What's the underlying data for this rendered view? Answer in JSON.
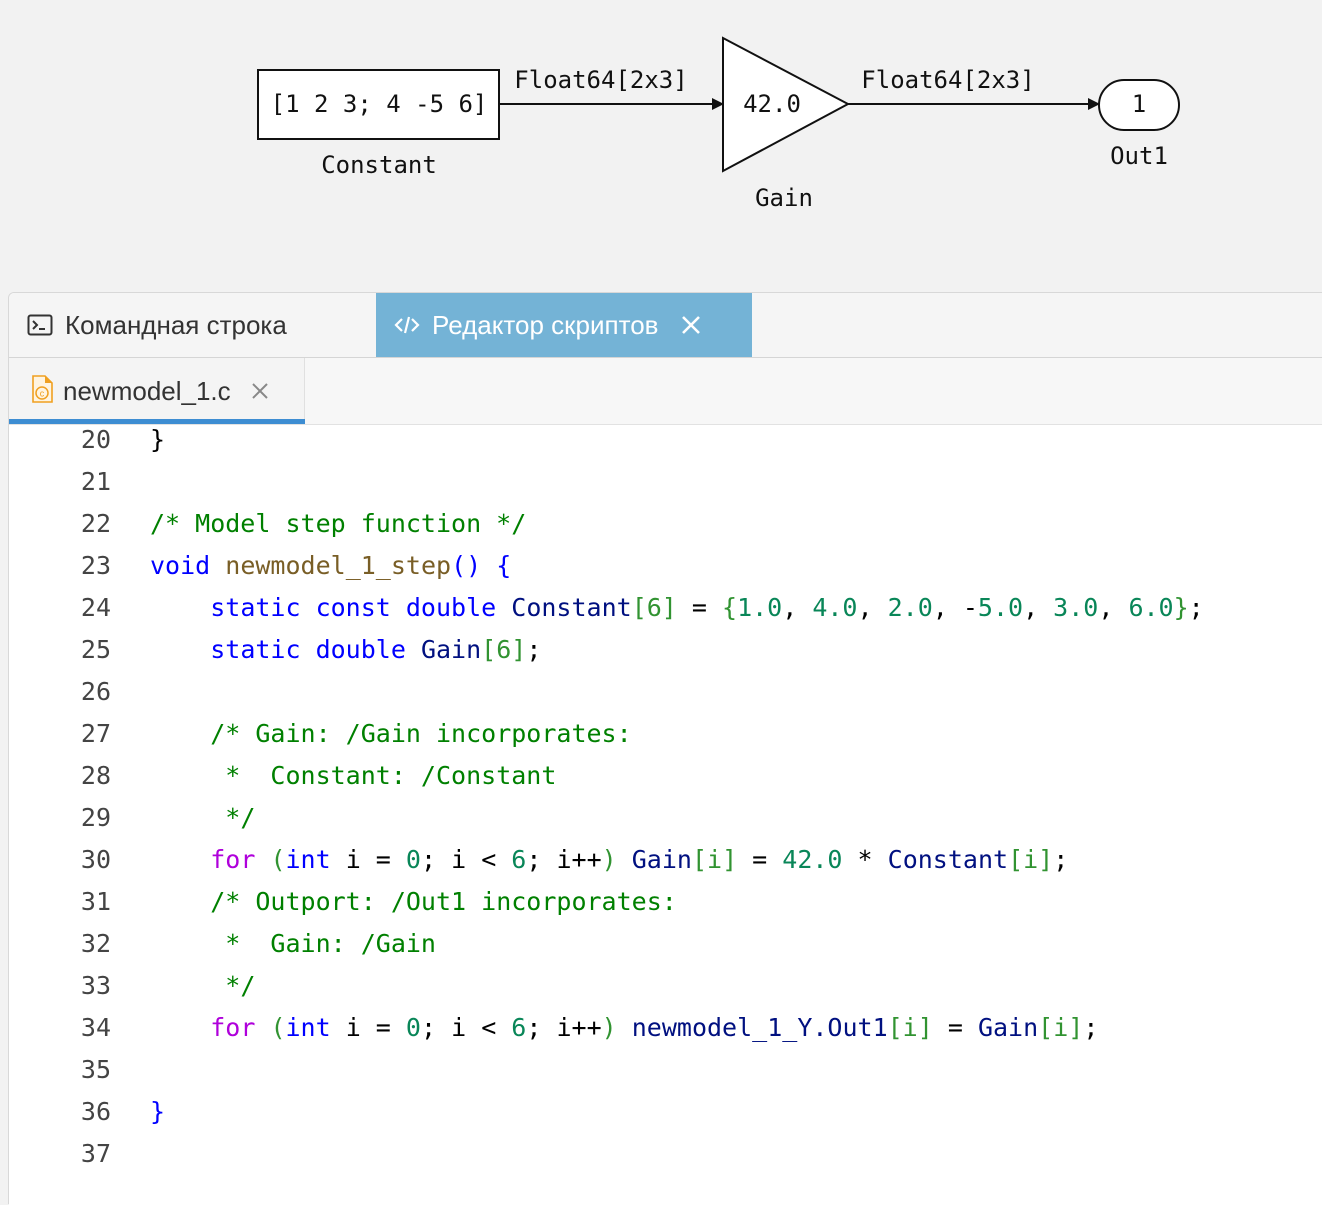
{
  "diagram": {
    "constant_block": {
      "value": "[1 2 3; 4 -5 6]",
      "label": "Constant"
    },
    "signal_1": {
      "label": "Float64[2x3]"
    },
    "gain_block": {
      "value": "42.0",
      "label": "Gain"
    },
    "signal_2": {
      "label": "Float64[2x3]"
    },
    "outport_block": {
      "value": "1",
      "label": "Out1"
    }
  },
  "panel_tabs": {
    "command_line": {
      "label": "Командная строка",
      "icon": "terminal-icon"
    },
    "script_editor": {
      "label": "Редактор скриптов",
      "icon": "code-icon",
      "active": true
    }
  },
  "file_tab": {
    "name": "newmodel_1.c",
    "icon": "c-file-icon"
  },
  "colors": {
    "active_tab_bg": "#74b3d6",
    "file_tab_underline": "#3d8dd2",
    "comment": "#008000",
    "keyword": "#0000ff",
    "control": "#af00db",
    "function": "#795e26",
    "variable": "#001080",
    "number": "#098658"
  },
  "code_lines": [
    {
      "n": "20",
      "tokens": [
        [
          "pl",
          "}"
        ]
      ]
    },
    {
      "n": "21",
      "tokens": []
    },
    {
      "n": "22",
      "tokens": [
        [
          "cmt",
          "/* Model step function */"
        ]
      ]
    },
    {
      "n": "23",
      "tokens": [
        [
          "kw",
          "void"
        ],
        [
          "pl",
          " "
        ],
        [
          "fn",
          "newmodel_1_step"
        ],
        [
          "kw",
          "() {"
        ]
      ]
    },
    {
      "n": "24",
      "tokens": [
        [
          "pl",
          "    "
        ],
        [
          "kw",
          "static const double"
        ],
        [
          "pl",
          " "
        ],
        [
          "var",
          "Constant"
        ],
        [
          "br",
          "[6]"
        ],
        [
          "pl",
          " = "
        ],
        [
          "br",
          "{"
        ],
        [
          "num",
          "1.0"
        ],
        [
          "pl",
          ", "
        ],
        [
          "num",
          "4.0"
        ],
        [
          "pl",
          ", "
        ],
        [
          "num",
          "2.0"
        ],
        [
          "pl",
          ", -"
        ],
        [
          "num",
          "5.0"
        ],
        [
          "pl",
          ", "
        ],
        [
          "num",
          "3.0"
        ],
        [
          "pl",
          ", "
        ],
        [
          "num",
          "6.0"
        ],
        [
          "br",
          "}"
        ],
        [
          "pl",
          ";"
        ]
      ]
    },
    {
      "n": "25",
      "tokens": [
        [
          "pl",
          "    "
        ],
        [
          "kw",
          "static double"
        ],
        [
          "pl",
          " "
        ],
        [
          "var",
          "Gain"
        ],
        [
          "br",
          "[6]"
        ],
        [
          "pl",
          ";"
        ]
      ]
    },
    {
      "n": "26",
      "tokens": []
    },
    {
      "n": "27",
      "tokens": [
        [
          "pl",
          "    "
        ],
        [
          "cmt",
          "/* Gain: /Gain incorporates:"
        ]
      ]
    },
    {
      "n": "28",
      "tokens": [
        [
          "pl",
          "    "
        ],
        [
          "cmt",
          " *  Constant: /Constant"
        ]
      ]
    },
    {
      "n": "29",
      "tokens": [
        [
          "pl",
          "    "
        ],
        [
          "cmt",
          " */"
        ]
      ]
    },
    {
      "n": "30",
      "tokens": [
        [
          "pl",
          "    "
        ],
        [
          "ctl",
          "for"
        ],
        [
          "pl",
          " "
        ],
        [
          "br",
          "("
        ],
        [
          "kw",
          "int"
        ],
        [
          "pl",
          " i = "
        ],
        [
          "num",
          "0"
        ],
        [
          "pl",
          "; i < "
        ],
        [
          "num",
          "6"
        ],
        [
          "pl",
          "; i++"
        ],
        [
          "br",
          ")"
        ],
        [
          "pl",
          " "
        ],
        [
          "var",
          "Gain"
        ],
        [
          "br",
          "[i]"
        ],
        [
          "pl",
          " = "
        ],
        [
          "num",
          "42.0"
        ],
        [
          "pl",
          " * "
        ],
        [
          "var",
          "Constant"
        ],
        [
          "br",
          "[i]"
        ],
        [
          "pl",
          ";"
        ]
      ]
    },
    {
      "n": "31",
      "tokens": [
        [
          "pl",
          "    "
        ],
        [
          "cmt",
          "/* Outport: /Out1 incorporates:"
        ]
      ]
    },
    {
      "n": "32",
      "tokens": [
        [
          "pl",
          "    "
        ],
        [
          "cmt",
          " *  Gain: /Gain"
        ]
      ]
    },
    {
      "n": "33",
      "tokens": [
        [
          "pl",
          "    "
        ],
        [
          "cmt",
          " */"
        ]
      ]
    },
    {
      "n": "34",
      "tokens": [
        [
          "pl",
          "    "
        ],
        [
          "ctl",
          "for"
        ],
        [
          "pl",
          " "
        ],
        [
          "br",
          "("
        ],
        [
          "kw",
          "int"
        ],
        [
          "pl",
          " i = "
        ],
        [
          "num",
          "0"
        ],
        [
          "pl",
          "; i < "
        ],
        [
          "num",
          "6"
        ],
        [
          "pl",
          "; i++"
        ],
        [
          "br",
          ")"
        ],
        [
          "pl",
          " "
        ],
        [
          "var",
          "newmodel_1_Y.Out1"
        ],
        [
          "br",
          "[i]"
        ],
        [
          "pl",
          " = "
        ],
        [
          "var",
          "Gain"
        ],
        [
          "br",
          "[i]"
        ],
        [
          "pl",
          ";"
        ]
      ]
    },
    {
      "n": "35",
      "tokens": []
    },
    {
      "n": "36",
      "tokens": [
        [
          "kw",
          "}"
        ]
      ]
    },
    {
      "n": "37",
      "tokens": []
    }
  ]
}
